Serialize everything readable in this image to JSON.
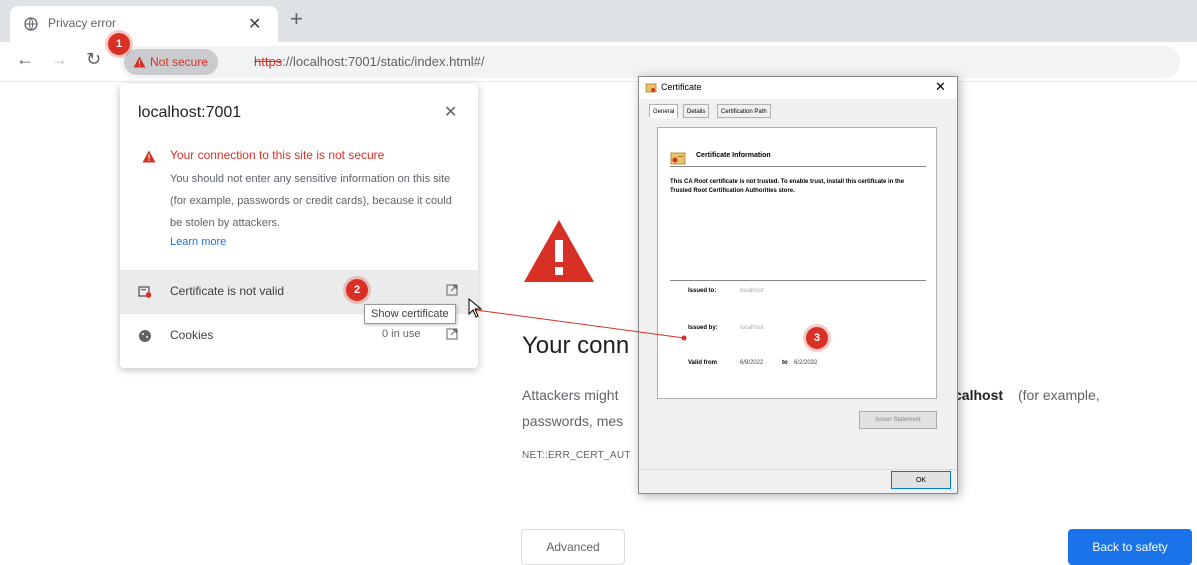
{
  "browser": {
    "tab_title": "Privacy error",
    "security_chip": "Not secure",
    "url_scheme": "https",
    "url_rest": "://localhost:7001/static/index.html#/"
  },
  "steps": [
    "1",
    "2",
    "3"
  ],
  "site_info": {
    "host": "localhost:7001",
    "warning_title": "Your connection to this site is not secure",
    "warning_body": "You should not enter any sensitive information on this site (for example, passwords or credit cards), because it could be stolen by attackers.",
    "learn_more": "Learn more",
    "certificate_label": "Certificate is not valid",
    "cookies_label": "Cookies",
    "cookies_count": "0 in use",
    "tooltip": "Show certificate"
  },
  "interstitial": {
    "heading": "Your conn",
    "body_line1": "Attackers might",
    "body_host": "calhost",
    "body_suffix": "(for example,",
    "body_line2": "passwords, mes",
    "error_code": "NET::ERR_CERT_AUT",
    "advanced_label": "Advanced",
    "back_label": "Back to safety"
  },
  "certificate_dialog": {
    "title": "Certificate",
    "tabs": [
      "General",
      "Details",
      "Certification Path"
    ],
    "info_title": "Certificate Information",
    "info_text": "This CA Root certificate is not trusted. To enable trust, install this certificate in the Trusted Root Certification Authorities store.",
    "issued_to_label": "Issued to:",
    "issued_to_value": "localhost",
    "issued_by_label": "Issued by:",
    "issued_by_value": "localhost",
    "valid_from_label": "Valid from",
    "valid_from_value": "6/9/2022",
    "valid_to_label": "to",
    "valid_to_value": "6/2/2032",
    "issuer_statement": "Issuer Statement",
    "ok_label": "OK"
  },
  "colors": {
    "danger": "#d93025",
    "link": "#1a73e8",
    "primary_button": "#1a73e8"
  }
}
